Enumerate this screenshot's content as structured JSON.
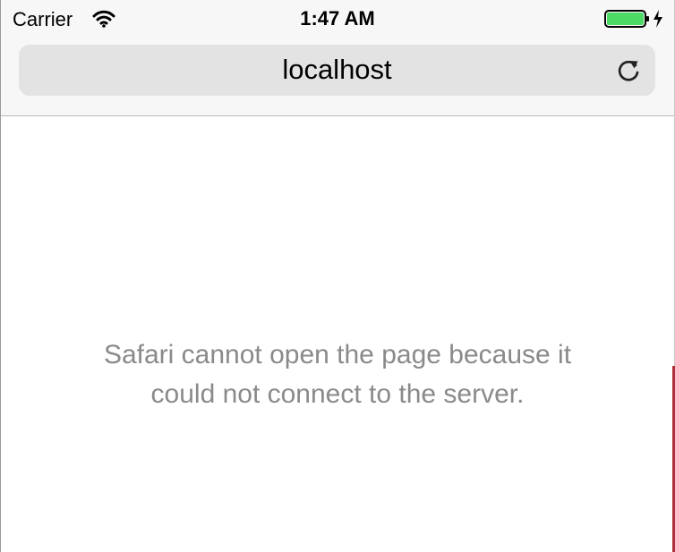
{
  "status_bar": {
    "carrier": "Carrier",
    "time": "1:47 AM",
    "battery_color": "#4cd964",
    "wifi_icon": "wifi-icon",
    "charging_icon": "charging-bolt-icon"
  },
  "address_bar": {
    "host": "localhost",
    "reload_icon": "reload-icon"
  },
  "error": {
    "message": "Safari cannot open the page because it could not connect to the server."
  }
}
